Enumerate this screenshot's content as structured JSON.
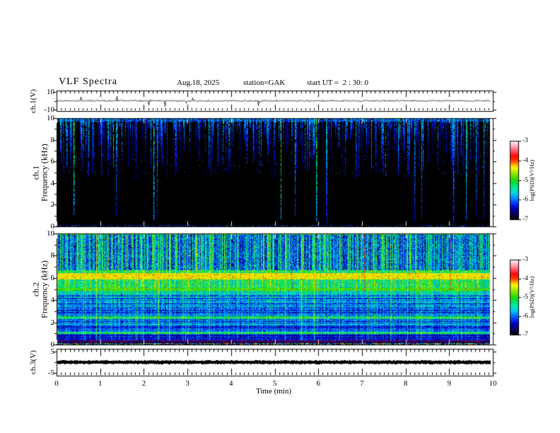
{
  "header": {
    "title": "VLF Spectra",
    "date": "Aug.18, 2025",
    "station": "station=GAK",
    "start_ut": "start UT =  2 : 30: 0"
  },
  "x_axis": {
    "label": "Time (min)",
    "ticks": [
      "0",
      "1",
      "2",
      "3",
      "4",
      "5",
      "6",
      "7",
      "8",
      "9",
      "10"
    ],
    "range_min": [
      0,
      10
    ],
    "minor_step_min": 0.1,
    "data_end_min": 9.93
  },
  "colorbar": {
    "label": "log(PSD)(V²/Hz)",
    "ticks": [
      "-3",
      "-4",
      "-5",
      "-6",
      "-7"
    ],
    "range": [
      -3,
      -7
    ],
    "stops": [
      [
        0.0,
        0,
        0,
        0
      ],
      [
        0.07,
        8,
        0,
        80
      ],
      [
        0.15,
        0,
        0,
        190
      ],
      [
        0.21,
        0,
        55,
        255
      ],
      [
        0.27,
        0,
        135,
        255
      ],
      [
        0.33,
        0,
        205,
        235
      ],
      [
        0.39,
        0,
        230,
        170
      ],
      [
        0.45,
        0,
        225,
        90
      ],
      [
        0.5,
        30,
        215,
        10
      ],
      [
        0.56,
        110,
        225,
        0
      ],
      [
        0.62,
        195,
        235,
        0
      ],
      [
        0.66,
        250,
        245,
        0
      ],
      [
        0.7,
        255,
        180,
        0
      ],
      [
        0.73,
        255,
        100,
        0
      ],
      [
        0.77,
        255,
        35,
        0
      ],
      [
        0.82,
        255,
        15,
        15
      ],
      [
        0.87,
        255,
        80,
        100
      ],
      [
        0.92,
        255,
        150,
        170
      ],
      [
        0.97,
        255,
        210,
        220
      ],
      [
        1.0,
        255,
        248,
        250
      ]
    ]
  },
  "chart_data": [
    {
      "id": "ch1_voltage",
      "type": "line",
      "ylabel": "ch.1(V)",
      "yticks": [
        "10",
        "-10"
      ],
      "ylim": [
        -11.6,
        11.6
      ],
      "xlim_min": [
        0,
        10
      ],
      "line_color": "#000000",
      "baseline_v": 0,
      "noise_amplitude_v": 0.8,
      "spike_prob": 0.012,
      "seed": 11
    },
    {
      "id": "ch1_spectrogram",
      "type": "heatmap",
      "channel": "ch.1",
      "ylabel": "Frequency (kHz)",
      "yticks": [
        "10",
        "8",
        "6",
        "4",
        "2",
        "0"
      ],
      "ylim_khz": [
        0,
        10
      ],
      "xlim_min": [
        0,
        10
      ],
      "background": "#000000",
      "value_range_log_psd": [
        -7,
        -3
      ],
      "features": "dense impulsive vertical streaks (sferics) descending from 10 kHz; most fade by 7-9 kHz; a few bright cyan-green streaks reach 0 kHz; faint speckle band near 5-6.5 kHz; thin speckle row at 0 kHz",
      "gen": {
        "seed": 23,
        "streak_prob": 0.5,
        "deep_prob": 0.035,
        "base_t": 0.27,
        "deep_t": 0.52
      }
    },
    {
      "id": "ch2_spectrogram",
      "type": "heatmap",
      "channel": "ch.2",
      "ylabel": "Frequency (kHz)",
      "yticks": [
        "10",
        "8",
        "6",
        "4",
        "2",
        "0"
      ],
      "ylim_khz": [
        0,
        10
      ],
      "xlim_min": [
        0,
        10
      ],
      "value_range_log_psd": [
        -7,
        -3
      ],
      "features": "broadband blue/cyan noise with dense vertical streaks above 6.7 kHz; bright yellow hiss band 5.9-6.45 kHz with red spots; cyan-green speckle 5.1-5.85 kHz; green line 4.85-5.1 kHz with red dots; banded blue structure 1-4.5 kHz; green bands near 1 and 2.45 kHz; dark bands 1.45-1.75 and 0.6-0.95 kHz; magenta line near 0.35 kHz; red-brown line near 0.2 kHz; multicolour speckle at 0 kHz",
      "gen": {
        "seed": 47,
        "hot_col_prob": 0.02,
        "red_col_prob": 0.011,
        "bands": [
          [
            10.0,
            6.7,
            0.34,
            0.15,
            "streaky"
          ],
          [
            6.7,
            6.45,
            0.45,
            0.11,
            ""
          ],
          [
            6.45,
            5.85,
            0.62,
            0.07,
            "hot"
          ],
          [
            5.85,
            5.1,
            0.44,
            0.13,
            ""
          ],
          [
            5.1,
            4.85,
            0.52,
            0.06,
            "hotdots"
          ],
          [
            4.85,
            4.45,
            0.36,
            0.1,
            ""
          ],
          [
            4.45,
            3.6,
            0.28,
            0.11,
            "striped"
          ],
          [
            3.6,
            2.55,
            0.26,
            0.11,
            "striped"
          ],
          [
            2.55,
            2.3,
            0.42,
            0.1,
            ""
          ],
          [
            2.3,
            1.75,
            0.27,
            0.1,
            "striped"
          ],
          [
            1.75,
            1.45,
            0.2,
            0.09,
            "striped"
          ],
          [
            1.45,
            1.15,
            0.24,
            0.09,
            ""
          ],
          [
            1.15,
            0.95,
            0.42,
            0.09,
            ""
          ],
          [
            0.95,
            0.58,
            0.2,
            0.08,
            "striped"
          ],
          [
            0.58,
            0.4,
            0.16,
            0.06,
            ""
          ],
          [
            0.4,
            0.3,
            0,
            0,
            "magenta"
          ],
          [
            0.3,
            0.12,
            0.12,
            0.05,
            "redline"
          ],
          [
            0.12,
            0.0,
            0,
            0,
            "speckle"
          ]
        ]
      }
    },
    {
      "id": "ch3_voltage",
      "type": "line",
      "ylabel": "ch.3(V)",
      "yticks": [
        "5",
        "-5"
      ],
      "ylim": [
        -6,
        6
      ],
      "xlim_min": [
        0,
        10
      ],
      "line_color": "#000000",
      "baseline_v": 0,
      "trace_thickness_px": 4,
      "seed": 7
    }
  ]
}
